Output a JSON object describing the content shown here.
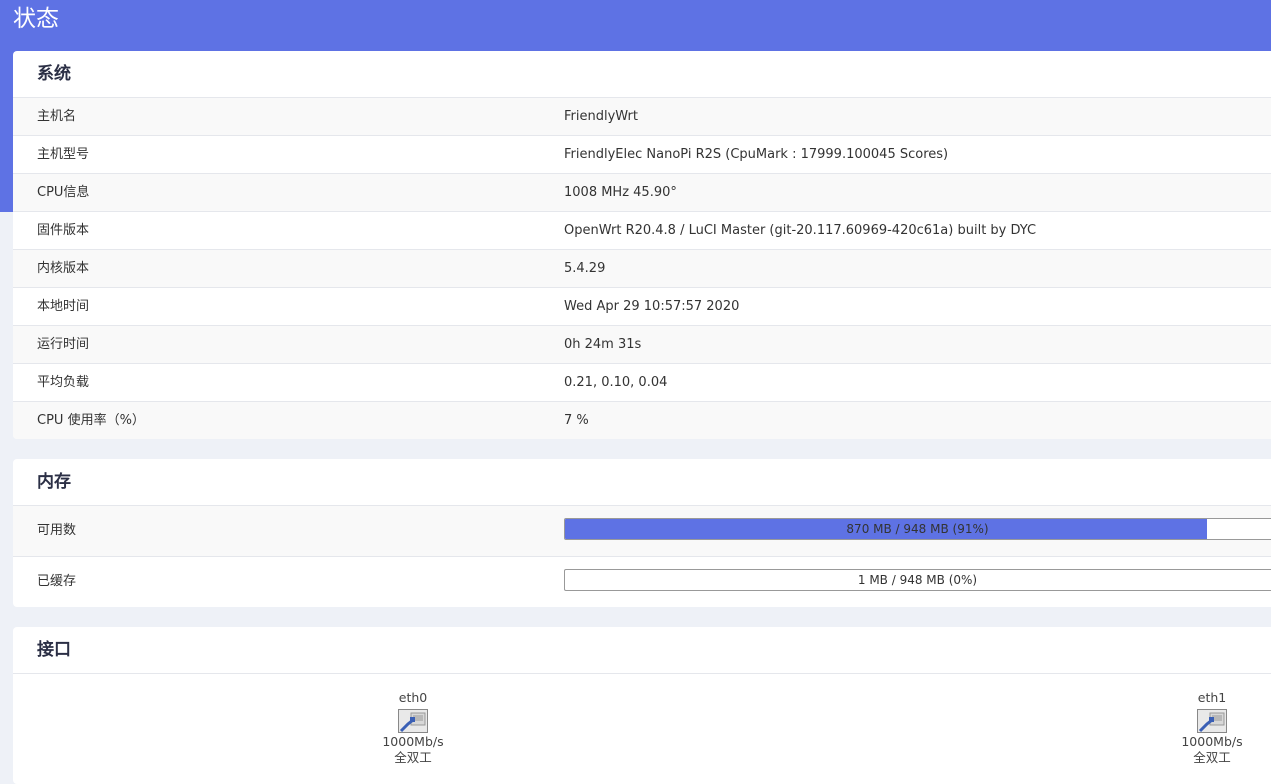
{
  "page": {
    "title": "状态"
  },
  "colors": {
    "accent": "#5e72e4",
    "background": "#eef1f7"
  },
  "system": {
    "title": "系统",
    "rows": [
      {
        "label": "主机名",
        "value": "FriendlyWrt"
      },
      {
        "label": "主机型号",
        "value": "FriendlyElec NanoPi R2S (CpuMark : 17999.100045 Scores)"
      },
      {
        "label": "CPU信息",
        "value": "1008 MHz 45.90°"
      },
      {
        "label": "固件版本",
        "value": "OpenWrt R20.4.8 / LuCI Master (git-20.117.60969-420c61a) built by DYC"
      },
      {
        "label": "内核版本",
        "value": "5.4.29"
      },
      {
        "label": "本地时间",
        "value": "Wed Apr 29 10:57:57 2020"
      },
      {
        "label": "运行时间",
        "value": "0h 24m 31s"
      },
      {
        "label": "平均负载",
        "value": "0.21, 0.10, 0.04"
      },
      {
        "label": "CPU 使用率（%）",
        "value": "7 %"
      }
    ]
  },
  "memory": {
    "title": "内存",
    "rows": [
      {
        "label": "可用数",
        "text": "870 MB / 948 MB (91%)",
        "percent": 91
      },
      {
        "label": "已缓存",
        "text": "1 MB / 948 MB (0%)",
        "percent": 0
      }
    ]
  },
  "interfaces": {
    "title": "接口",
    "items": [
      {
        "name": "eth0",
        "speed": "1000Mb/s",
        "duplex": "全双工",
        "icon": "ethernet-port-icon"
      },
      {
        "name": "eth1",
        "speed": "1000Mb/s",
        "duplex": "全双工",
        "icon": "ethernet-port-icon"
      }
    ]
  }
}
